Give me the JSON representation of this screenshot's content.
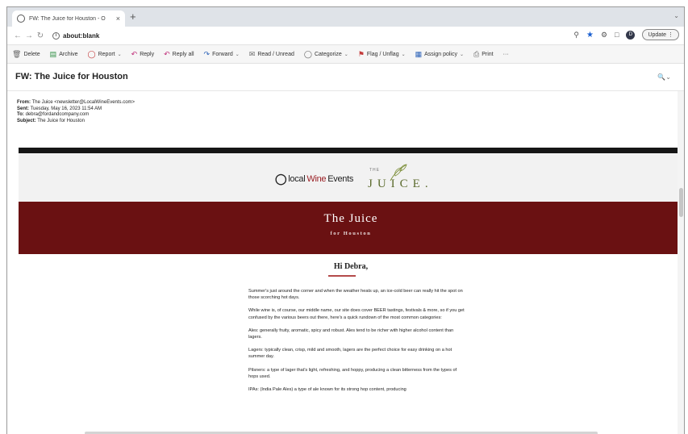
{
  "browser": {
    "tab_title": "FW: The Juice for Houston - O",
    "tab_close": "×",
    "new_tab": "+",
    "url": "about:blank",
    "update_label": "Update",
    "profile_initial": "D"
  },
  "commands": [
    {
      "label": "Delete",
      "icon": "trash-icon"
    },
    {
      "label": "Archive",
      "icon": "archive-icon"
    },
    {
      "label": "Report",
      "icon": "report-icon",
      "dropdown": true
    },
    {
      "label": "Reply",
      "icon": "reply-icon"
    },
    {
      "label": "Reply all",
      "icon": "reply-all-icon"
    },
    {
      "label": "Forward",
      "icon": "forward-icon",
      "dropdown": true
    },
    {
      "label": "Read / Unread",
      "icon": "envelope-icon"
    },
    {
      "label": "Categorize",
      "icon": "tag-icon",
      "dropdown": true
    },
    {
      "label": "Flag / Unflag",
      "icon": "flag-icon",
      "dropdown": true
    },
    {
      "label": "Assign policy",
      "icon": "policy-icon",
      "dropdown": true
    },
    {
      "label": "Print",
      "icon": "print-icon"
    },
    {
      "label": "···",
      "icon": "more-icon"
    }
  ],
  "message": {
    "subject_title": "FW: The Juice for Houston",
    "from_label": "From:",
    "from_value": "The Juice <newsletter@LocalWineEvents.com>",
    "sent_label": "Sent:",
    "sent_value": "Tuesday, May 16, 2023 11:54 AM",
    "to_label": "To:",
    "to_value": "debra@fordandcompany.com",
    "subject_label": "Subject:",
    "subject_value": "The Juice for Houston"
  },
  "newsletter": {
    "lwe_logo_local": "local",
    "lwe_logo_wine": "Wine",
    "lwe_logo_events": "Events",
    "juice_logo_the": "THE",
    "juice_logo_word": "JUICE.",
    "banner_title": "The Juice",
    "banner_subtitle": "for Houston",
    "greeting": "Hi Debra,",
    "paragraphs": [
      "Summer's just around the corner and when the weather heats up, an ice-cold beer can really hit the spot on those scorching hot days.",
      "While wine is, of course, our middle name, our site does cover BEER tastings, festivals & more, so if you get confused by the various beers out there, here's a quick rundown of the most common categories:",
      "Ales: generally fruity, aromatic, spicy and robust. Ales tend to be richer with higher alcohol content than lagers.",
      "Lagers: typically clean, crisp, mild and smooth, lagers are the perfect choice for easy drinking on a hot summer day.",
      "Pilsners: a type of lager that's light, refreshing, and hoppy, producing a clean bitterness from the types of hops used.",
      "IPAs: (India Pale Ales) a type of ale known for its strong hop content, producing"
    ]
  }
}
